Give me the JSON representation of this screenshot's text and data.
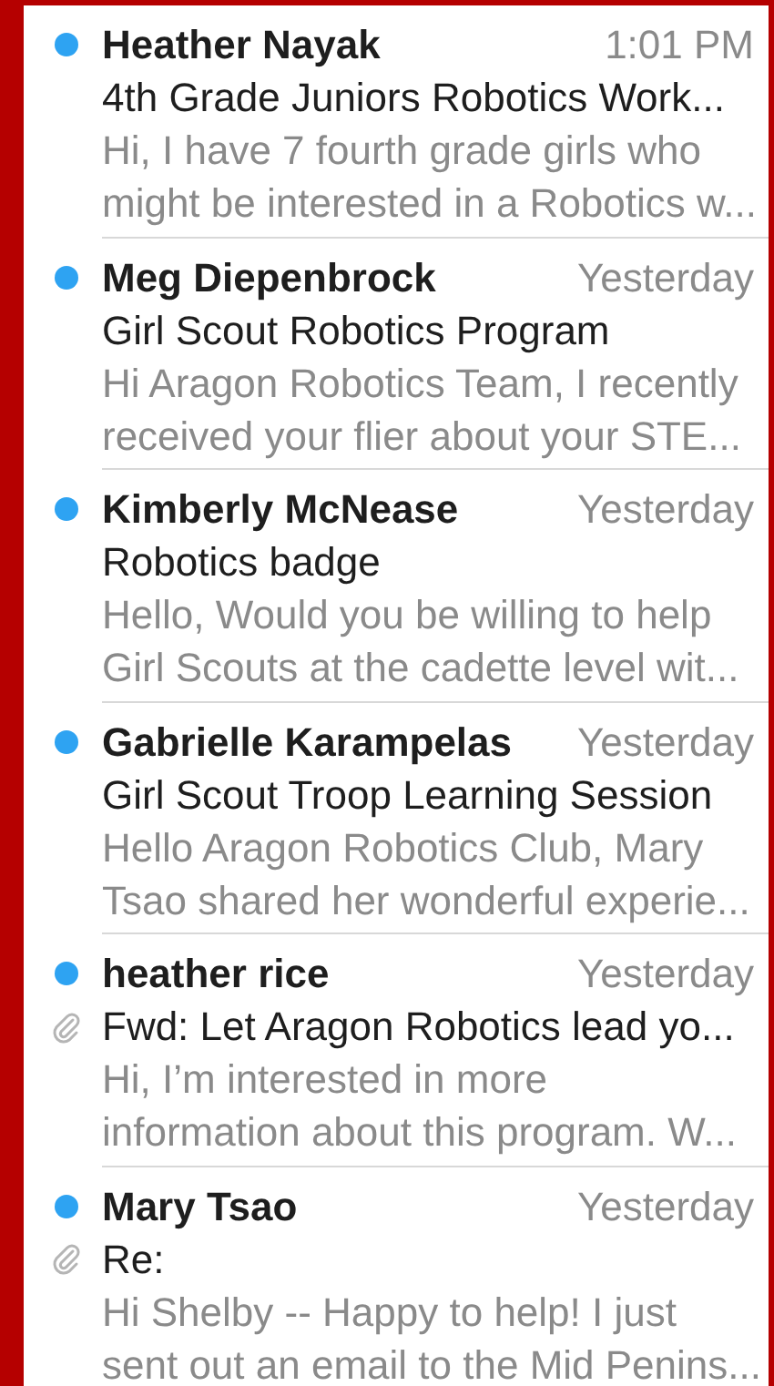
{
  "messages": [
    {
      "sender": "Heather Nayak",
      "time": "1:01 PM",
      "subject": "4th Grade Juniors Robotics Work...",
      "preview": [
        "Hi, I have 7 fourth grade girls who",
        "might be interested in a Robotics w..."
      ],
      "unread": true,
      "attachment": false
    },
    {
      "sender": "Meg Diepenbrock",
      "time": "Yesterday",
      "subject": "Girl Scout Robotics Program",
      "preview": [
        "Hi Aragon Robotics Team, I recently",
        "received your flier about your STE..."
      ],
      "unread": true,
      "attachment": false
    },
    {
      "sender": "Kimberly McNease",
      "time": "Yesterday",
      "subject": "Robotics badge",
      "preview": [
        "Hello, Would you be willing to help",
        "Girl Scouts at the cadette level wit..."
      ],
      "unread": true,
      "attachment": false
    },
    {
      "sender": "Gabrielle Karampelas",
      "time": "Yesterday",
      "subject": "Girl Scout Troop Learning Session",
      "preview": [
        "Hello Aragon Robotics Club,  Mary",
        "Tsao shared her wonderful experie..."
      ],
      "unread": true,
      "attachment": false
    },
    {
      "sender": "heather rice",
      "time": "Yesterday",
      "subject": "Fwd: Let Aragon Robotics lead yo...",
      "preview": [
        "Hi, I’m interested in more",
        "information about this program. W..."
      ],
      "unread": true,
      "attachment": true
    },
    {
      "sender": "Mary Tsao",
      "time": "Yesterday",
      "subject": "Re:",
      "preview": [
        "Hi Shelby -- Happy to help! I just",
        "sent out an email to the Mid Penins..."
      ],
      "unread": true,
      "attachment": true
    }
  ]
}
